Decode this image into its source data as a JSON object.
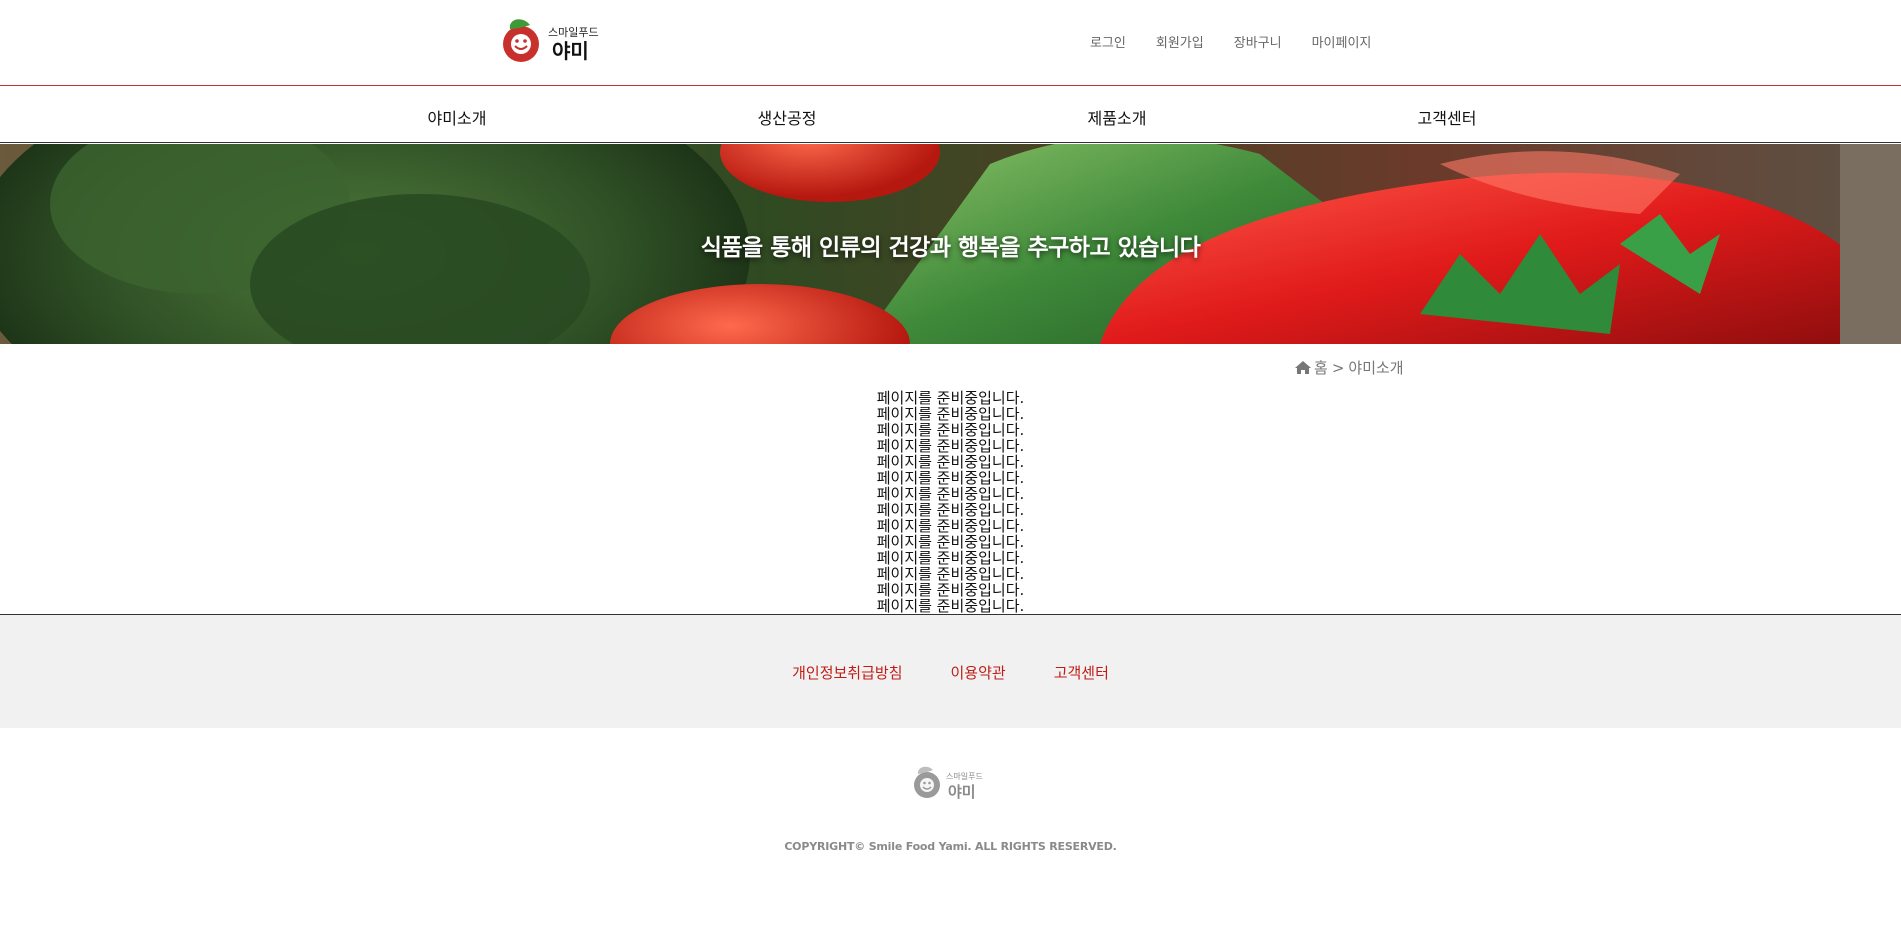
{
  "brand": {
    "logo_text_top": "스마일푸드",
    "logo_text_main": "야미",
    "accent_red": "#c8312b",
    "leaf_green": "#3f9a35",
    "link_red": "#c01d18"
  },
  "utility_menu": [
    {
      "label": "로그인"
    },
    {
      "label": "회원가입"
    },
    {
      "label": "장바구니"
    },
    {
      "label": "마이페이지"
    }
  ],
  "main_nav": [
    {
      "label": "야미소개"
    },
    {
      "label": "생산공정"
    },
    {
      "label": "제품소개"
    },
    {
      "label": "고객센터"
    }
  ],
  "hero": {
    "title": "식품을 통해 인류의 건강과 행복을 추구하고 있습니다"
  },
  "breadcrumb": {
    "home_icon": "home-icon",
    "home": "홈",
    "separator": ">",
    "current": "야미소개"
  },
  "content": {
    "lines": [
      "페이지를 준비중입니다.",
      "페이지를 준비중입니다.",
      "페이지를 준비중입니다.",
      "페이지를 준비중입니다.",
      "페이지를 준비중입니다.",
      "페이지를 준비중입니다.",
      "페이지를 준비중입니다.",
      "페이지를 준비중입니다.",
      "페이지를 준비중입니다.",
      "페이지를 준비중입니다.",
      "페이지를 준비중입니다.",
      "페이지를 준비중입니다.",
      "페이지를 준비중입니다.",
      "페이지를 준비중입니다."
    ]
  },
  "footer": {
    "links": [
      {
        "label": "개인정보취급방침"
      },
      {
        "label": "이용약관"
      },
      {
        "label": "고객센터"
      }
    ],
    "copyright": "COPYRIGHT© Smile Food Yami. ALL RIGHTS RESERVED."
  }
}
